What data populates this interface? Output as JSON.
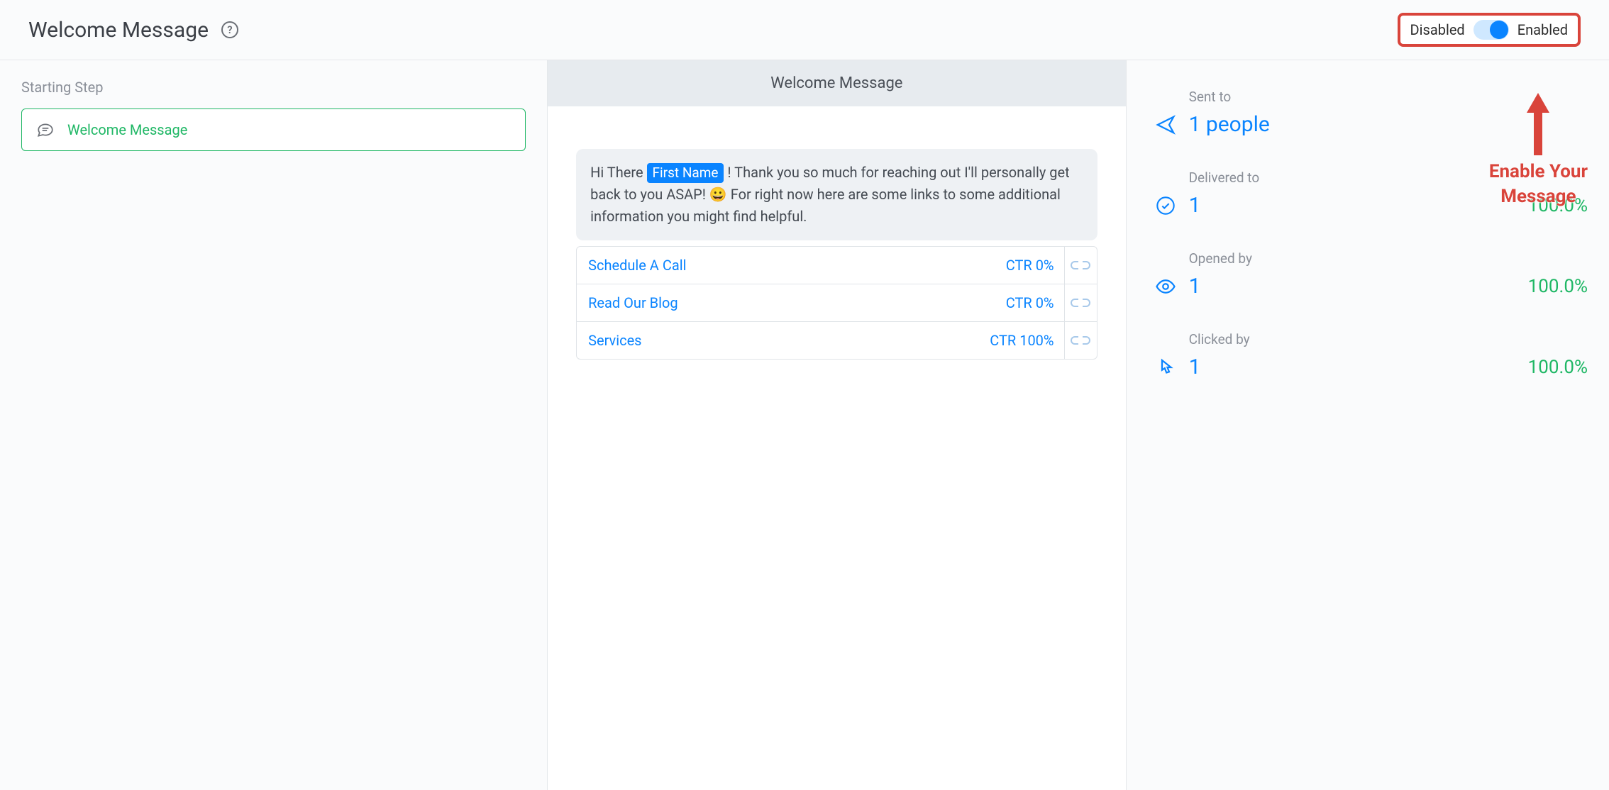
{
  "header": {
    "title": "Welcome Message",
    "help_glyph": "?",
    "toggle": {
      "left_label": "Disabled",
      "right_label": "Enabled",
      "state": "enabled"
    }
  },
  "left": {
    "section_label": "Starting Step",
    "step_label": "Welcome Message"
  },
  "preview": {
    "header": "Welcome Message",
    "msg_parts": {
      "before_tag": "Hi There ",
      "tag": "First Name",
      "after_tag_1": " ! Thank you so much for reaching out I'll personally get back to you ASAP! ",
      "emoji": "😀",
      "after_tag_2": " For right now here are some links to some additional information you might find helpful."
    },
    "buttons": [
      {
        "label": "Schedule A Call",
        "ctr": "CTR 0%"
      },
      {
        "label": "Read Our Blog",
        "ctr": "CTR 0%"
      },
      {
        "label": "Services",
        "ctr": "CTR 100%"
      }
    ]
  },
  "stats": {
    "sent": {
      "label": "Sent to",
      "value": "1 people"
    },
    "delivered": {
      "label": "Delivered to",
      "value": "1",
      "pct": "100.0%"
    },
    "opened": {
      "label": "Opened by",
      "value": "1",
      "pct": "100.0%"
    },
    "clicked": {
      "label": "Clicked by",
      "value": "1",
      "pct": "100.0%"
    }
  },
  "annotation": {
    "line1": "Enable Your",
    "line2": "Message"
  }
}
